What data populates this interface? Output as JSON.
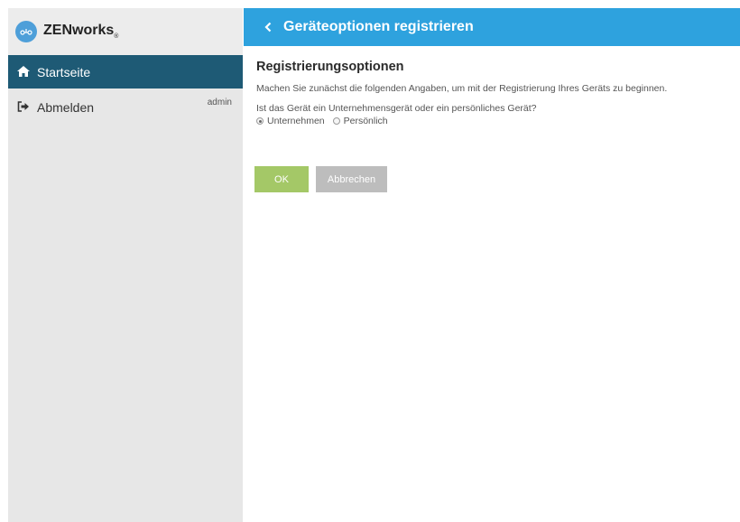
{
  "brand": {
    "name": "ZENworks",
    "reg": "®",
    "logo_icon": "zenworks-logo-icon",
    "accent": "#4e9fd9"
  },
  "sidebar": {
    "items": [
      {
        "label": "Startseite",
        "icon": "home-icon",
        "active": true
      },
      {
        "label": "Abmelden",
        "icon": "sign-out-icon",
        "user": "admin"
      }
    ],
    "active_color": "#1e5a75"
  },
  "header": {
    "title": "Geräteoptionen registrieren",
    "back_icon": "chevron-left-icon",
    "color": "#2ea2de"
  },
  "main": {
    "section_title": "Registrierungsoptionen",
    "intro": "Machen Sie zunächst die folgenden Angaben, um mit der Registrierung Ihres Geräts zu beginnen.",
    "question": "Ist das Gerät ein Unternehmensgerät oder ein persönliches Gerät?",
    "options": [
      {
        "label": "Unternehmen",
        "selected": true
      },
      {
        "label": "Persönlich",
        "selected": false
      }
    ],
    "ok_label": "OK",
    "cancel_label": "Abbrechen",
    "ok_color": "#a4c867",
    "cancel_color": "#bdbdbd"
  }
}
